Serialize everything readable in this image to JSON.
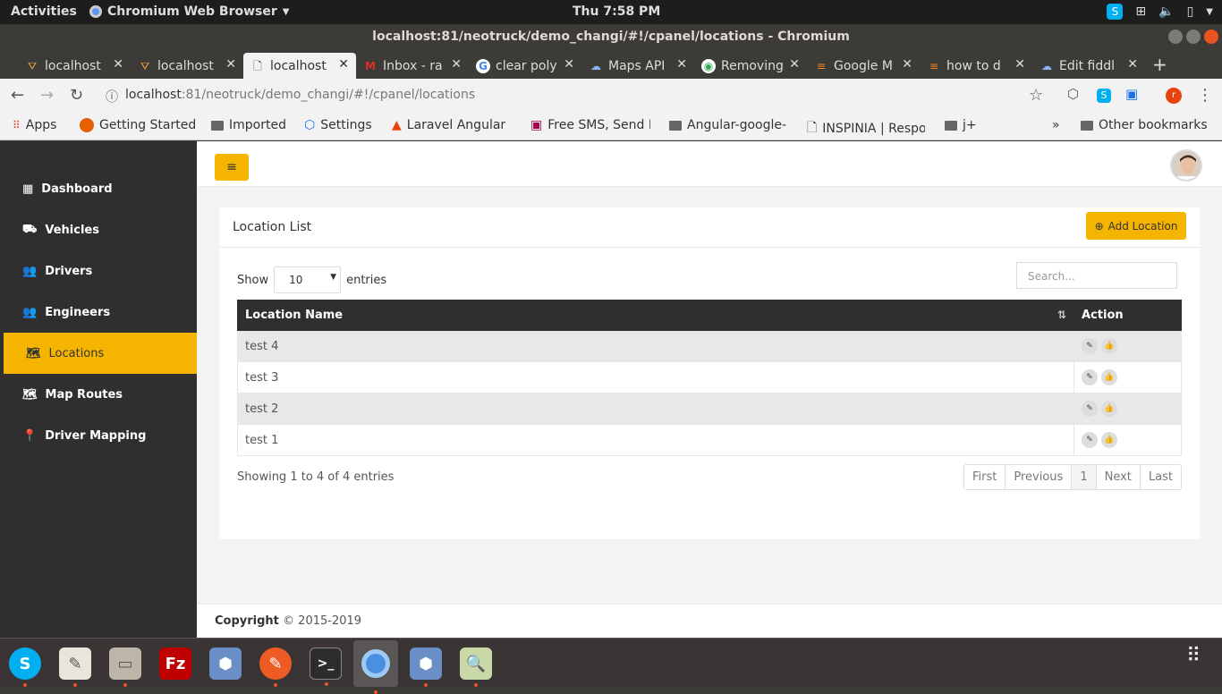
{
  "os": {
    "activities": "Activities",
    "app_name": "Chromium Web Browser",
    "clock": "Thu  7:58 PM"
  },
  "window": {
    "title": "localhost:81/neotruck/demo_changi/#!/cpanel/locations - Chromium"
  },
  "tabs": [
    {
      "label": "localhost",
      "icon": "localhost-icon"
    },
    {
      "label": "localhost",
      "icon": "localhost-icon"
    },
    {
      "label": "localhost",
      "icon": "page-icon"
    },
    {
      "label": "Inbox - ra",
      "icon": "gmail-icon"
    },
    {
      "label": "clear poly",
      "icon": "google-icon"
    },
    {
      "label": "Maps API",
      "icon": "maps-icon"
    },
    {
      "label": "Removing",
      "icon": "chrome-icon"
    },
    {
      "label": "Google M",
      "icon": "stackoverflow-icon"
    },
    {
      "label": "how to d",
      "icon": "stackoverflow-icon"
    },
    {
      "label": "Edit fiddl",
      "icon": "fiddle-icon"
    }
  ],
  "address": {
    "host": "localhost",
    "rest": ":81/neotruck/demo_changi/#!/cpanel/locations"
  },
  "bookmarks": [
    {
      "label": "Apps"
    },
    {
      "label": "Getting Started"
    },
    {
      "label": "Imported"
    },
    {
      "label": "Settings"
    },
    {
      "label": "Laravel Angular"
    },
    {
      "label": "Free SMS, Send F"
    },
    {
      "label": "Angular-google-"
    },
    {
      "label": "INSPINIA | Respo"
    },
    {
      "label": "j+"
    },
    {
      "label": "Other bookmarks"
    }
  ],
  "sidebar": {
    "items": [
      {
        "label": "Dashboard",
        "icon": "th-large-icon"
      },
      {
        "label": "Vehicles",
        "icon": "truck-icon"
      },
      {
        "label": "Drivers",
        "icon": "users-icon"
      },
      {
        "label": "Engineers",
        "icon": "users-icon"
      },
      {
        "label": "Locations",
        "icon": "map-icon",
        "active": true
      },
      {
        "label": "Map Routes",
        "icon": "map-icon"
      },
      {
        "label": "Driver Mapping",
        "icon": "map-marker-icon"
      }
    ]
  },
  "panel": {
    "title": "Location List",
    "add_label": "Add Location",
    "show_label": "Show",
    "entries_label": "entries",
    "page_size": "10",
    "search_placeholder": "Search...",
    "columns": [
      "Location Name",
      "Action"
    ],
    "rows": [
      "test 4",
      "test 3",
      "test 2",
      "test 1"
    ],
    "info": "Showing 1 to 4 of 4 entries",
    "pager": [
      "First",
      "Previous",
      "1",
      "Next",
      "Last"
    ]
  },
  "footer": {
    "bold": "Copyright",
    "text": " © 2015-2019"
  },
  "colors": {
    "accent": "#f5b400",
    "sidebar": "#2f2f2f",
    "table_header": "#2f2f2f"
  }
}
